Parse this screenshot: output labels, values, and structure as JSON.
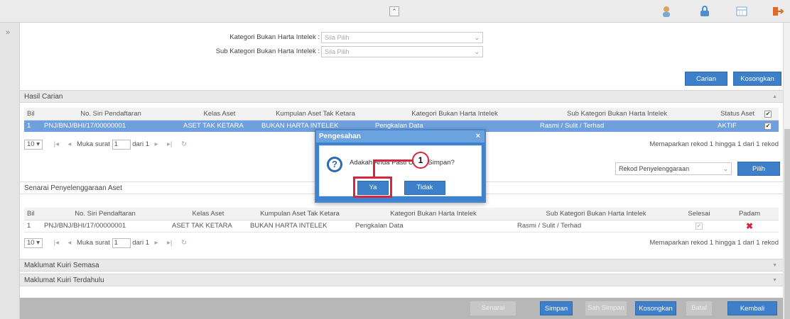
{
  "topbar": {
    "collapse_icon": "double-chevron-up-icon",
    "icons": [
      "user-icon",
      "lock-icon",
      "calendar-icon",
      "exit-icon"
    ]
  },
  "side": {
    "expand_glyph": "»"
  },
  "form": {
    "kategori_label": "Kategori Bukan Harta Intelek :",
    "kategori_placeholder": "Sila Pilih",
    "subkategori_label": "Sub Kategori Bukan Harta Intelek :",
    "subkategori_placeholder": "Sila Pilih",
    "carian_btn": "Carian",
    "kosongkan_btn": "Kosongkan"
  },
  "hasil": {
    "title": "Hasil Carian",
    "columns": [
      "Bil",
      "No. Siri Pendaftaran",
      "Kelas Aset",
      "Kumpulan Aset Tak Ketara",
      "Kategori Bukan Harta Intelek",
      "Sub Kategori Bukan Harta Intelek",
      "Status Aset"
    ],
    "row": {
      "bil": "1",
      "no_siri": "PNJ/BNJ/BHI/17/00000001",
      "kelas": "ASET TAK KETARA",
      "kumpulan": "BUKAN HARTA INTELEK",
      "kategori": "Pengkalan Data",
      "sub": "Rasmi / Sulit / Terhad",
      "status": "AKTIF"
    },
    "pager": {
      "page_size": "10",
      "muka_surat": "Muka surat",
      "page": "1",
      "dari": "dari 1",
      "summary": "Memaparkan rekod 1 hingga 1 dari 1 rekod"
    },
    "select_value": "Rekod Penyelenggaraan",
    "pilih_btn": "Pilih"
  },
  "senarai": {
    "title": "Senarai Penyelenggaraan Aset",
    "columns": [
      "Bil",
      "No. Siri Pendaftaran",
      "Kelas Aset",
      "Kumpulan Aset Tak Ketara",
      "Kategori Bukan Harta Intelek",
      "Sub Kategori Bukan Harta Intelek",
      "Selesai",
      "Padam"
    ],
    "row": {
      "bil": "1",
      "no_siri": "PNJ/BNJ/BHI/17/00000001",
      "kelas": "ASET TAK KETARA",
      "kumpulan": "BUKAN HARTA INTELEK",
      "kategori": "Pengkalan Data",
      "sub": "Rasmi / Sulit / Terhad"
    },
    "pager": {
      "page_size": "10",
      "muka_surat": "Muka surat",
      "page": "1",
      "dari": "dari 1",
      "summary": "Memaparkan rekod 1 hingga 1 dari 1 rekod"
    }
  },
  "sections": {
    "kuiri_semasa": "Maklumat Kuiri Semasa",
    "kuiri_terdahulu": "Maklumat Kuiri Terdahulu"
  },
  "footer": {
    "senarai_semak": "Senarai Semak",
    "simpan": "Simpan",
    "sah_simpan": "Sah Simpan",
    "kosongkan": "Kosongkan",
    "batal": "Batal",
    "kembali": "Kembali"
  },
  "dialog": {
    "title": "Pengesahan",
    "message": "Adakah Anda Pasti Untuk Simpan?",
    "ya": "Ya",
    "tidak": "Tidak",
    "close": "×"
  },
  "annotation": {
    "step": "1",
    "color": "#d7263d"
  }
}
